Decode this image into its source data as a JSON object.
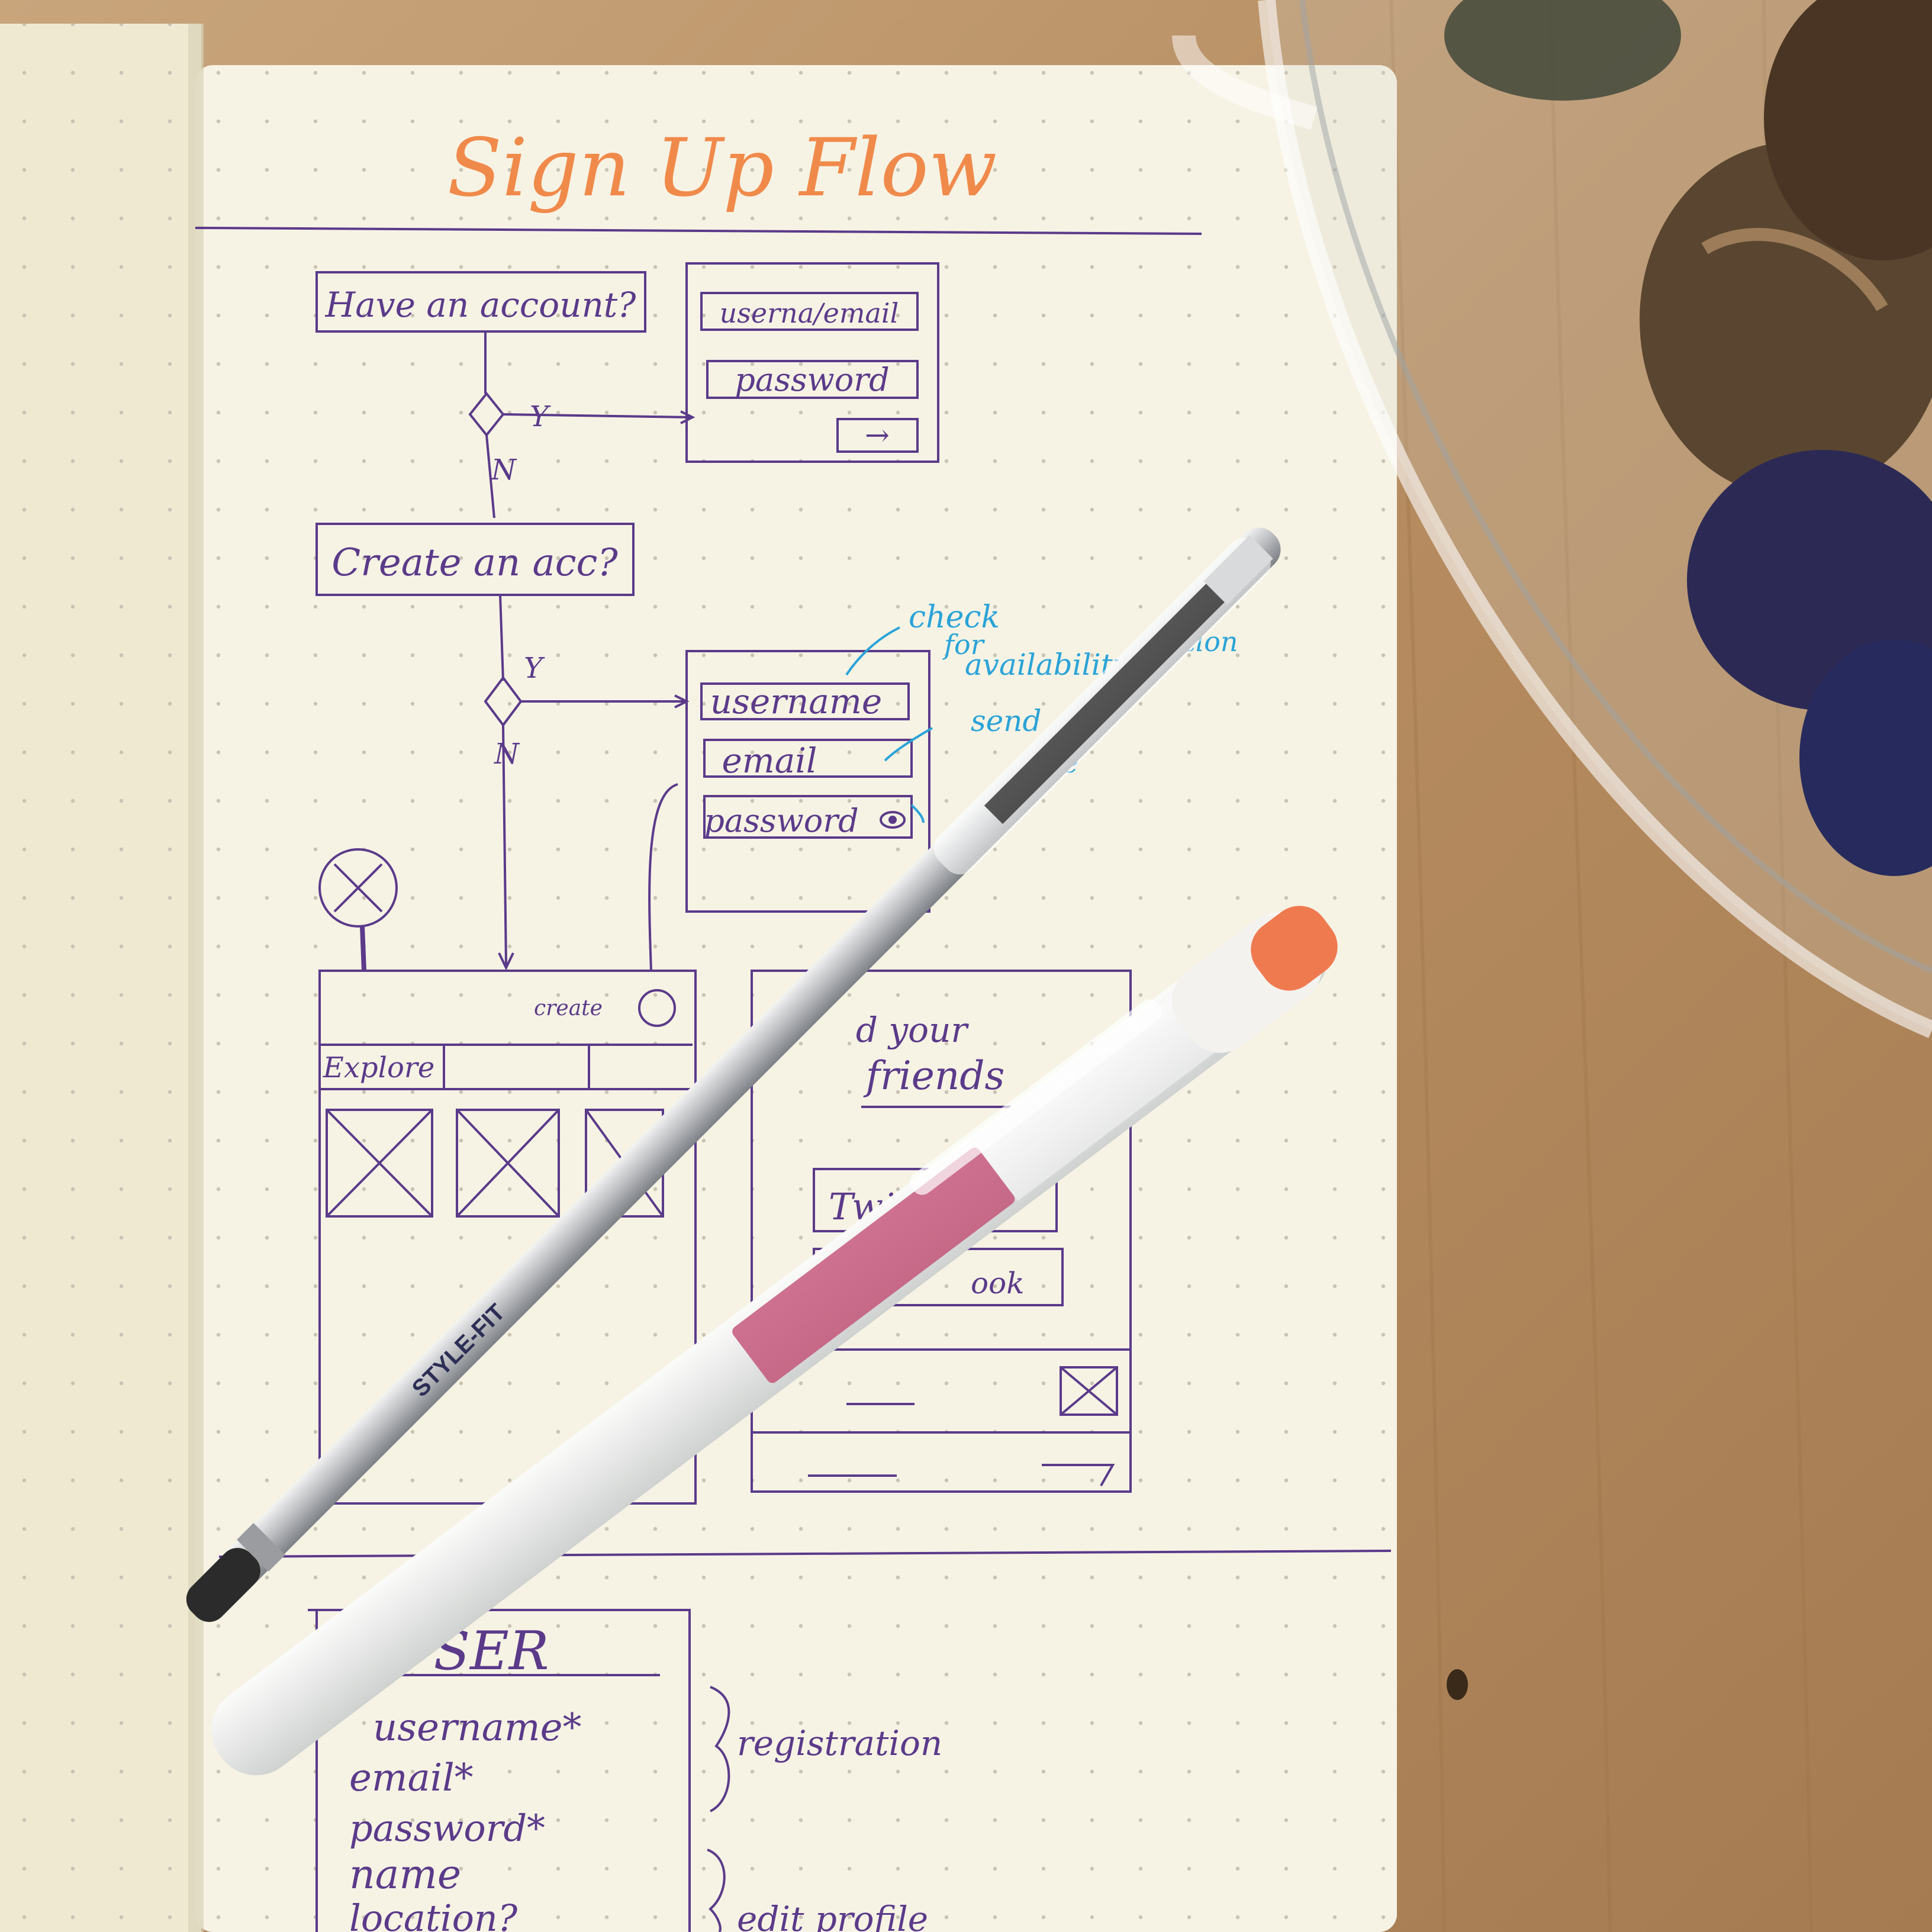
{
  "title": "Sign Up Flow",
  "flow": {
    "q_have_account": "Have an account?",
    "q_create_account": "Create an acc?",
    "yes": "Y",
    "no": "N"
  },
  "login": {
    "username_email": "userna/email",
    "password": "password",
    "submit": "→"
  },
  "signup": {
    "username": "username",
    "email": "email",
    "password": "password"
  },
  "notes": {
    "check_1": "check",
    "check_2": "for",
    "check_3": "availability",
    "send": "send",
    "confirmation_tail": "mation",
    "e_tail": "e"
  },
  "explore": {
    "create": "create",
    "tab": "Explore"
  },
  "friends": {
    "line1": "d your",
    "line2": "friends",
    "twitter": "Twit",
    "facebook": "ook"
  },
  "user_model": {
    "heading": "SER",
    "fields": [
      "username*",
      "email*",
      "password*",
      "name",
      "location?"
    ],
    "registration": "registration",
    "profile": "edit profile"
  },
  "pens": {
    "silver_label": "STYLE-FIT"
  },
  "colors": {
    "ink": "#5b3a8a",
    "orange": "#f08a4b",
    "blue": "#2aa3d8",
    "paper": "#f6f3e4",
    "wood": "#b8926a"
  }
}
